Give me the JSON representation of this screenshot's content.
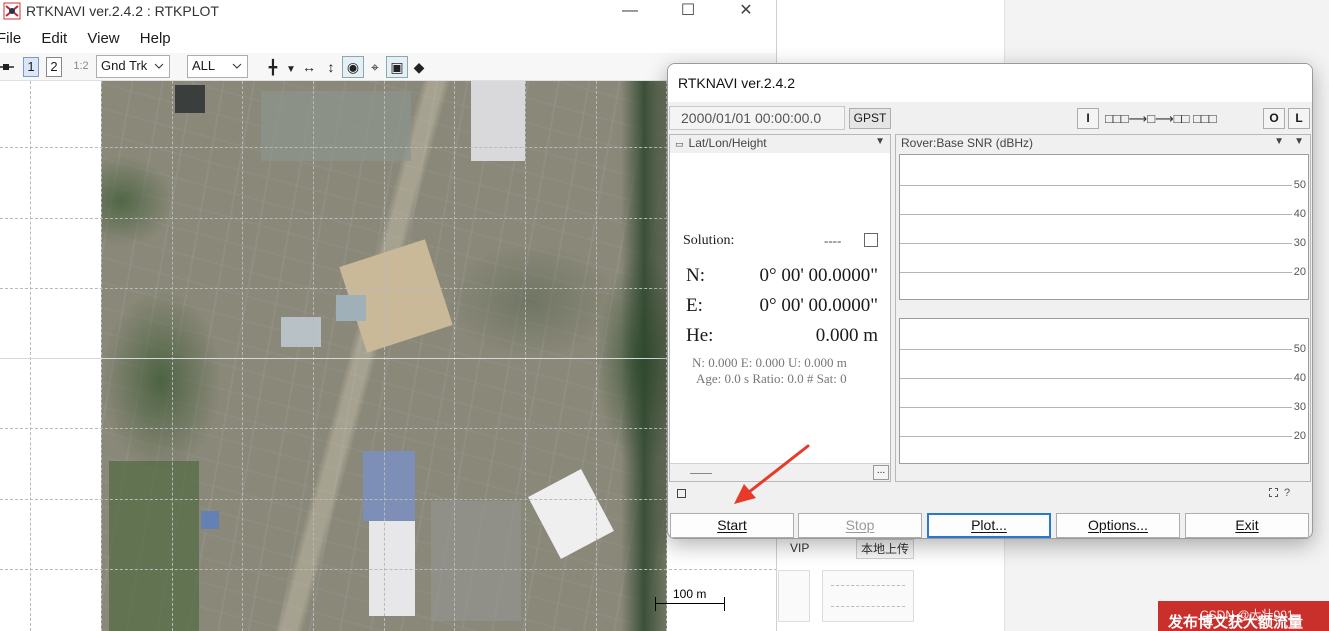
{
  "background": {
    "vip_label": "VIP",
    "upload_label": "本地上传",
    "banner_text": "发布博文获大额流量",
    "watermark": "CSDN @大壮001"
  },
  "plot_window": {
    "title": "RTKNAVI ver.2.4.2 : RTKPLOT",
    "controls": {
      "minimize": "—",
      "maximize": "☐",
      "close": "✕"
    },
    "menu": [
      "File",
      "Edit",
      "View",
      "Help"
    ],
    "toolbar": {
      "btn_1": "1",
      "btn_2": "2",
      "btn_12": "1:2",
      "plot_type": "Gnd Trk",
      "sat_filter": "ALL"
    },
    "scale_label": "100 m"
  },
  "navi": {
    "title": "RTKNAVI ver.2.4.2",
    "time": "2000/01/01 00:00:00.0",
    "time_system": "GPST",
    "btn_i": "I",
    "stream_indicator": "□□□⟶□⟶□□ □□□",
    "btn_o": "O",
    "btn_l": "L",
    "solution_panel": {
      "header": "Lat/Lon/Height",
      "solution_label": "Solution:",
      "solution_status": "----",
      "n_label": "N:",
      "n_value": "0° 00' 00.0000\"",
      "e_label": "E:",
      "e_value": "0° 00' 00.0000\"",
      "he_label": "He:",
      "he_value": "0.000 m",
      "enu_line": "N: 0.000 E: 0.000 U: 0.000 m",
      "age_line": "Age: 0.0 s Ratio: 0.0 # Sat: 0"
    },
    "snr_panel": {
      "header": "Rover:Base SNR (dBHz)",
      "ticks": [
        "50",
        "40",
        "30",
        "20"
      ]
    },
    "status_right": "?",
    "buttons": {
      "start": "Start",
      "stop": "Stop",
      "plot": "Plot...",
      "options": "Options...",
      "exit": "Exit"
    }
  },
  "colors": {
    "annotation_arrow": "#e8392b",
    "focus_border": "#2b78d4",
    "banner": "#c9302c"
  }
}
